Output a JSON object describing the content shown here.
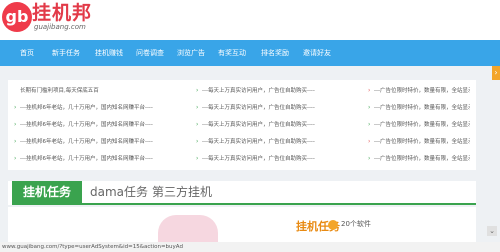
{
  "header": {
    "logo_mark": "gb",
    "site_name": "挂机邦",
    "domain": "guajibang.com"
  },
  "nav": [
    {
      "label": "首页"
    },
    {
      "label": "新手任务"
    },
    {
      "label": "挂机赚钱"
    },
    {
      "label": "问卷调查"
    },
    {
      "label": "浏览广告"
    },
    {
      "label": "有奖互动"
    },
    {
      "label": "排名奖励"
    },
    {
      "label": "邀请好友"
    }
  ],
  "notice_rows": [
    [
      "长期有门槛利项目,每天保底五百",
      "---每天上万真实访问用户，广告位自助购买----",
      "---广告位限时特价，数量有限，全站显示---"
    ],
    [
      "---挂机邦6年老站，几十万用户，国内知名网赚平台----",
      "---每天上万真实访问用户，广告位自助购买----",
      "---广告位限时特价，数量有限，全站显示---"
    ],
    [
      "---挂机邦6年老站，几十万用户，国内知名网赚平台----",
      "---每天上万真实访问用户，广告位自助购买----",
      "---广告位限时特价，数量有限，全站显示---"
    ],
    [
      "---挂机邦6年老站，几十万用户，国内知名网赚平台----",
      "---每天上万真实访问用户，广告位自助购买----",
      "---广告位限时特价，数量有限，全站显示---"
    ],
    [
      "---挂机邦6年老站，几十万用户，国内知名网赚平台----",
      "---每天上万真实访问用户，广告位自助购买----",
      "---广告位限时特价，数量有限，全站显示---"
    ]
  ],
  "tabs": {
    "active": "挂机任务",
    "items": [
      "dama任务",
      "第三方挂机"
    ]
  },
  "product": {
    "title": "挂机任务",
    "count": "20个软件"
  },
  "status_bar": {
    "url": "www.guajibang.com/?type=userAdSystem&id=15&action=buyAd"
  },
  "colors": {
    "nav_bg": "#39a5e8",
    "tab_green": "#3aa34e",
    "brand_red": "#e23a48"
  }
}
